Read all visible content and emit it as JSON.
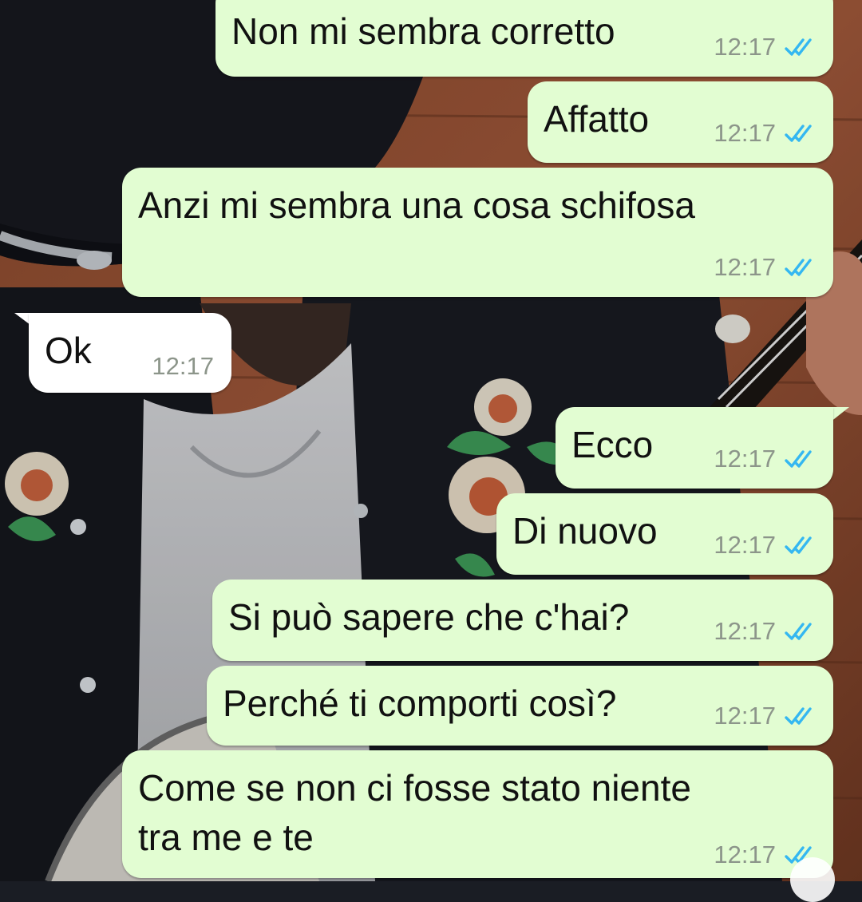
{
  "conversation": {
    "messages": [
      {
        "direction": "outgoing",
        "text": "Non mi sembra corretto",
        "time": "12:17",
        "status": "read"
      },
      {
        "direction": "outgoing",
        "text": "Affatto",
        "time": "12:17",
        "status": "read"
      },
      {
        "direction": "outgoing",
        "text": "Anzi mi sembra una cosa schifosa",
        "time": "12:17",
        "status": "read"
      },
      {
        "direction": "incoming",
        "text": "Ok",
        "time": "12:17"
      },
      {
        "direction": "outgoing",
        "text": "Ecco",
        "time": "12:17",
        "status": "read"
      },
      {
        "direction": "outgoing",
        "text": "Di nuovo",
        "time": "12:17",
        "status": "read"
      },
      {
        "direction": "outgoing",
        "text": "Si può sapere che c'hai?",
        "time": "12:17",
        "status": "read"
      },
      {
        "direction": "outgoing",
        "text": "Perché ti comporti così?",
        "time": "12:17",
        "status": "read"
      },
      {
        "direction": "outgoing",
        "text": "Come se non ci fosse stato niente\ntra me e te",
        "time": "12:17",
        "status": "read"
      }
    ]
  },
  "colors": {
    "outgoing_bubble": "#e2fdd2",
    "incoming_bubble": "#ffffff",
    "read_tick": "#34b7f1",
    "timestamp": "#8c958a"
  },
  "icons": {
    "read_receipt": "double-check-icon"
  },
  "wallpaper": {
    "kind": "photo"
  }
}
